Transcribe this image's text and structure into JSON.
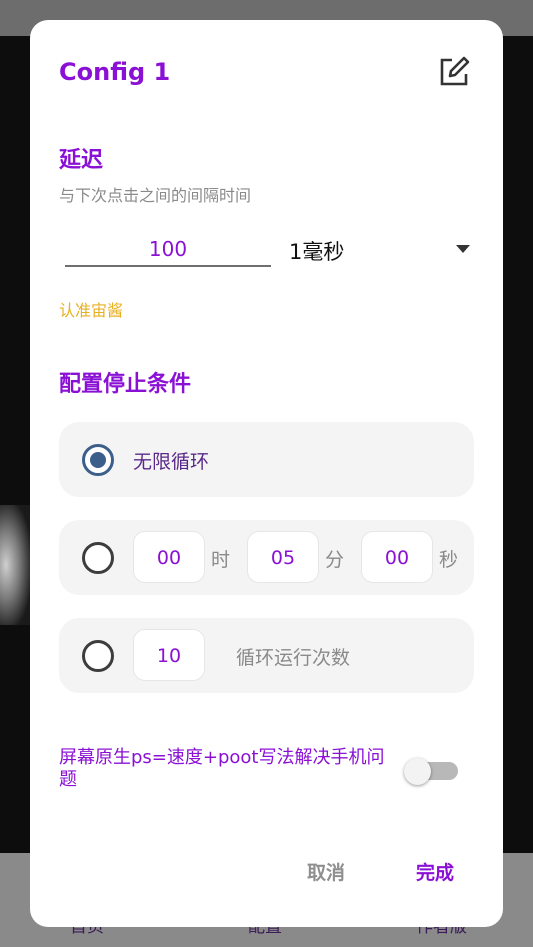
{
  "dialog": {
    "title": "Config 1",
    "edit_icon": "edit-square-icon"
  },
  "delay": {
    "section_title": "延迟",
    "subtitle": "与下次点击之间的间隔时间",
    "value": "100",
    "unit": "1毫秒",
    "hint": "认准宙酱"
  },
  "stop_conditions": {
    "section_title": "配置停止条件",
    "infinite_label": "无限循环",
    "infinite_selected": true,
    "timer": {
      "hours": "00",
      "hours_unit": "时",
      "minutes": "05",
      "minutes_unit": "分",
      "seconds": "00",
      "seconds_unit": "秒"
    },
    "loop": {
      "count": "10",
      "label": "循环运行次数"
    }
  },
  "toggle": {
    "label": "屏幕原生ps=速度+poot写法解决手机问题",
    "enabled": false
  },
  "buttons": {
    "cancel": "取消",
    "done": "完成"
  },
  "bottom_nav": {
    "items": [
      "首页",
      "配置",
      "作者版"
    ]
  },
  "colors": {
    "accent": "#8b10d6",
    "hint": "#e9b020",
    "radio_selected": "#3b5f8a"
  }
}
